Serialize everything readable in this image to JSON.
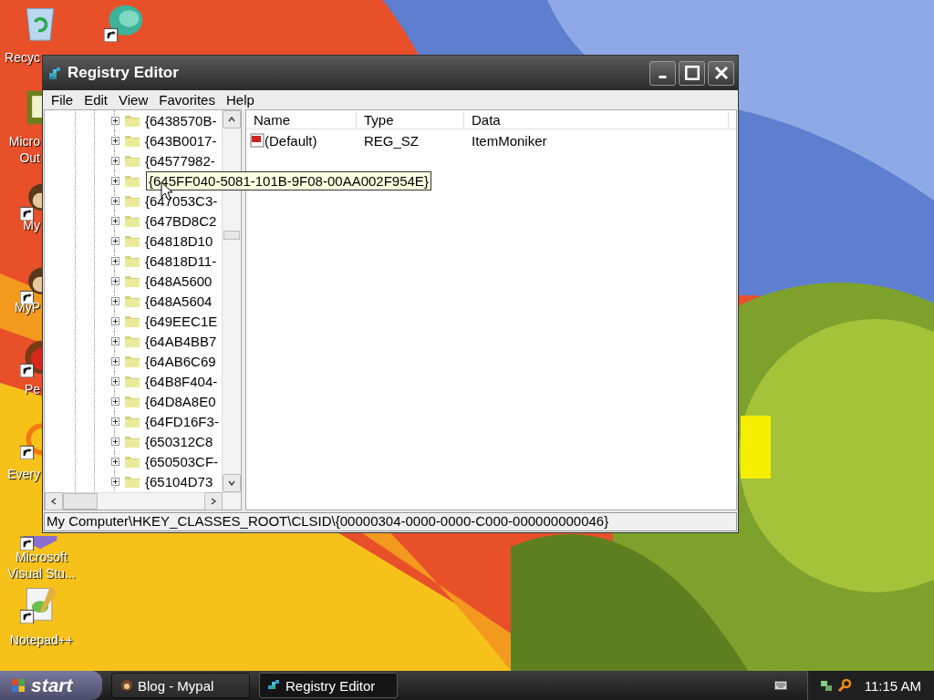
{
  "desktop_icons": [
    {
      "kind": "bin",
      "label": "Recyc",
      "shortcut": false
    },
    {
      "kind": "bubble",
      "shortcut": true
    },
    {
      "kind": "calendar",
      "label": "Micro Out",
      "shortcut": false
    },
    {
      "kind": "monkey",
      "label": "My",
      "shortcut": true
    },
    {
      "kind": "monkey",
      "label": "MyP",
      "shortcut": true
    },
    {
      "kind": "ball",
      "label": "Pe",
      "shortcut": true
    },
    {
      "kind": "ring",
      "label": "Every",
      "shortcut": true
    },
    {
      "kind": "cube",
      "label": "Microsoft Visual Stu...",
      "shortcut": true
    },
    {
      "kind": "notepad",
      "label": "Notepad++",
      "shortcut": true
    }
  ],
  "window": {
    "title": "Registry Editor"
  },
  "menu": [
    "File",
    "Edit",
    "View",
    "Favorites",
    "Help"
  ],
  "tree": {
    "items": [
      {
        "label": "{6438570B-"
      },
      {
        "label": "{643B0017-"
      },
      {
        "label": "{64577982-"
      },
      {
        "tooltip": "{645FF040-5081-101B-9F08-00AA002F954E}"
      },
      {
        "label": "{647053C3-"
      },
      {
        "label": "{647BD8C2"
      },
      {
        "label": "{64818D10"
      },
      {
        "label": "{64818D11-"
      },
      {
        "label": "{648A5600"
      },
      {
        "label": "{648A5604"
      },
      {
        "label": "{649EEC1E"
      },
      {
        "label": "{64AB4BB7"
      },
      {
        "label": "{64AB6C69"
      },
      {
        "label": "{64B8F404-"
      },
      {
        "label": "{64D8A8E0"
      },
      {
        "label": "{64FD16F3-"
      },
      {
        "label": "{650312C8"
      },
      {
        "label": "{650503CF-"
      },
      {
        "label": "{65104D73"
      }
    ]
  },
  "list": {
    "columns": [
      "Name",
      "Type",
      "Data"
    ],
    "rows": [
      {
        "name": "(Default)",
        "type": "REG_SZ",
        "data": "ItemMoniker"
      }
    ]
  },
  "status_bar": "My Computer\\HKEY_CLASSES_ROOT\\CLSID\\{00000304-0000-0000-C000-000000000046}",
  "taskbar": {
    "start": "start",
    "tasks": [
      {
        "label": "Blog - Mypal",
        "selected": false
      },
      {
        "label": "Registry Editor",
        "selected": true
      }
    ],
    "clock": "11:15 AM"
  }
}
